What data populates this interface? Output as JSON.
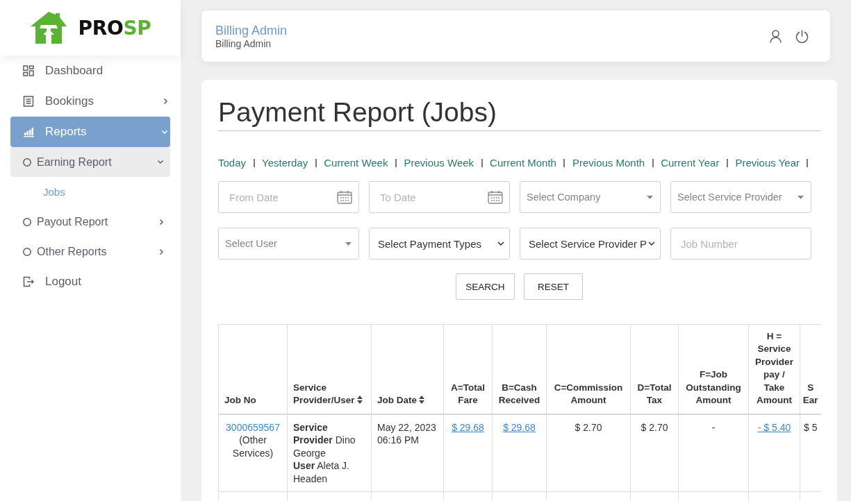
{
  "sidebar": {
    "logo": {
      "text": "PRO",
      "accent": "SP"
    },
    "items": [
      {
        "kind": "link",
        "label": "Dashboard",
        "selected": false
      },
      {
        "kind": "group",
        "label": "Bookings",
        "selected": false,
        "expanded": false
      },
      {
        "kind": "group",
        "label": "Reports",
        "selected": true,
        "expanded": true,
        "children": [
          {
            "kind": "group",
            "label": "Earning Report",
            "selected": true,
            "expanded": true,
            "children": [
              {
                "kind": "link",
                "label": "Jobs",
                "selected": true
              }
            ]
          },
          {
            "kind": "group",
            "label": "Payout Report",
            "selected": false,
            "expanded": false
          },
          {
            "kind": "group",
            "label": "Other Reports",
            "selected": false,
            "expanded": false
          }
        ]
      },
      {
        "kind": "link",
        "label": "Logout",
        "selected": false
      }
    ]
  },
  "header": {
    "user_name": "Billing Admin",
    "user_role": "Billing Admin"
  },
  "report": {
    "title": "Payment Report (Jobs)",
    "quick_ranges": [
      "Today",
      "Yesterday",
      "Current Week",
      "Previous Week",
      "Current Month",
      "Previous Month",
      "Current Year",
      "Previous Year"
    ],
    "filters": [
      {
        "kind": "date",
        "placeholder": "From Date"
      },
      {
        "kind": "date",
        "placeholder": "To Date"
      },
      {
        "kind": "dropdown",
        "placeholder": "Select Company"
      },
      {
        "kind": "dropdown",
        "placeholder": "Select Service Provider"
      },
      {
        "kind": "dropdown",
        "placeholder": "Select User"
      },
      {
        "kind": "select",
        "value": "Select Payment Types"
      },
      {
        "kind": "select",
        "value": "Select Service Provider P"
      },
      {
        "kind": "text",
        "placeholder": "Job Number"
      }
    ],
    "buttons": [
      {
        "label": "SEARCH"
      },
      {
        "label": "RESET"
      }
    ],
    "table": {
      "columns": [
        {
          "label": "Job No",
          "sortable": false
        },
        {
          "label": "Service Provider/User",
          "sortable": true
        },
        {
          "label": "Job Date",
          "sortable": true
        },
        {
          "label": "A=Total Fare",
          "sortable": false
        },
        {
          "label": "B=Cash Received",
          "sortable": false
        },
        {
          "label": "C=Commission Amount",
          "sortable": false
        },
        {
          "label": "D=Total Tax",
          "sortable": false
        },
        {
          "label": "F=Job Outstanding Amount",
          "sortable": false
        },
        {
          "label": "H = Service Provider pay / Take Amount",
          "sortable": false
        },
        {
          "label": "S Ear",
          "sortable": false
        }
      ],
      "rows": [
        {
          "job_no": "3000659567",
          "job_type": "(Other Services)",
          "provider": "**Service Provider** Dino George",
          "user": "**User** Aleta J. Headen",
          "job_date": "May 22, 2023 06:16 PM",
          "amounts": [
            {
              "text": "$ 29.68",
              "link": true
            },
            {
              "text": "$ 29.68",
              "link": true
            },
            {
              "text": "$ 2.70",
              "link": false
            },
            {
              "text": "$ 2.70",
              "link": false
            },
            {
              "text": "-",
              "link": false
            },
            {
              "text": "- $ 5.40",
              "link": true
            },
            {
              "text": "$ 5",
              "link": false
            }
          ]
        }
      ]
    }
  }
}
